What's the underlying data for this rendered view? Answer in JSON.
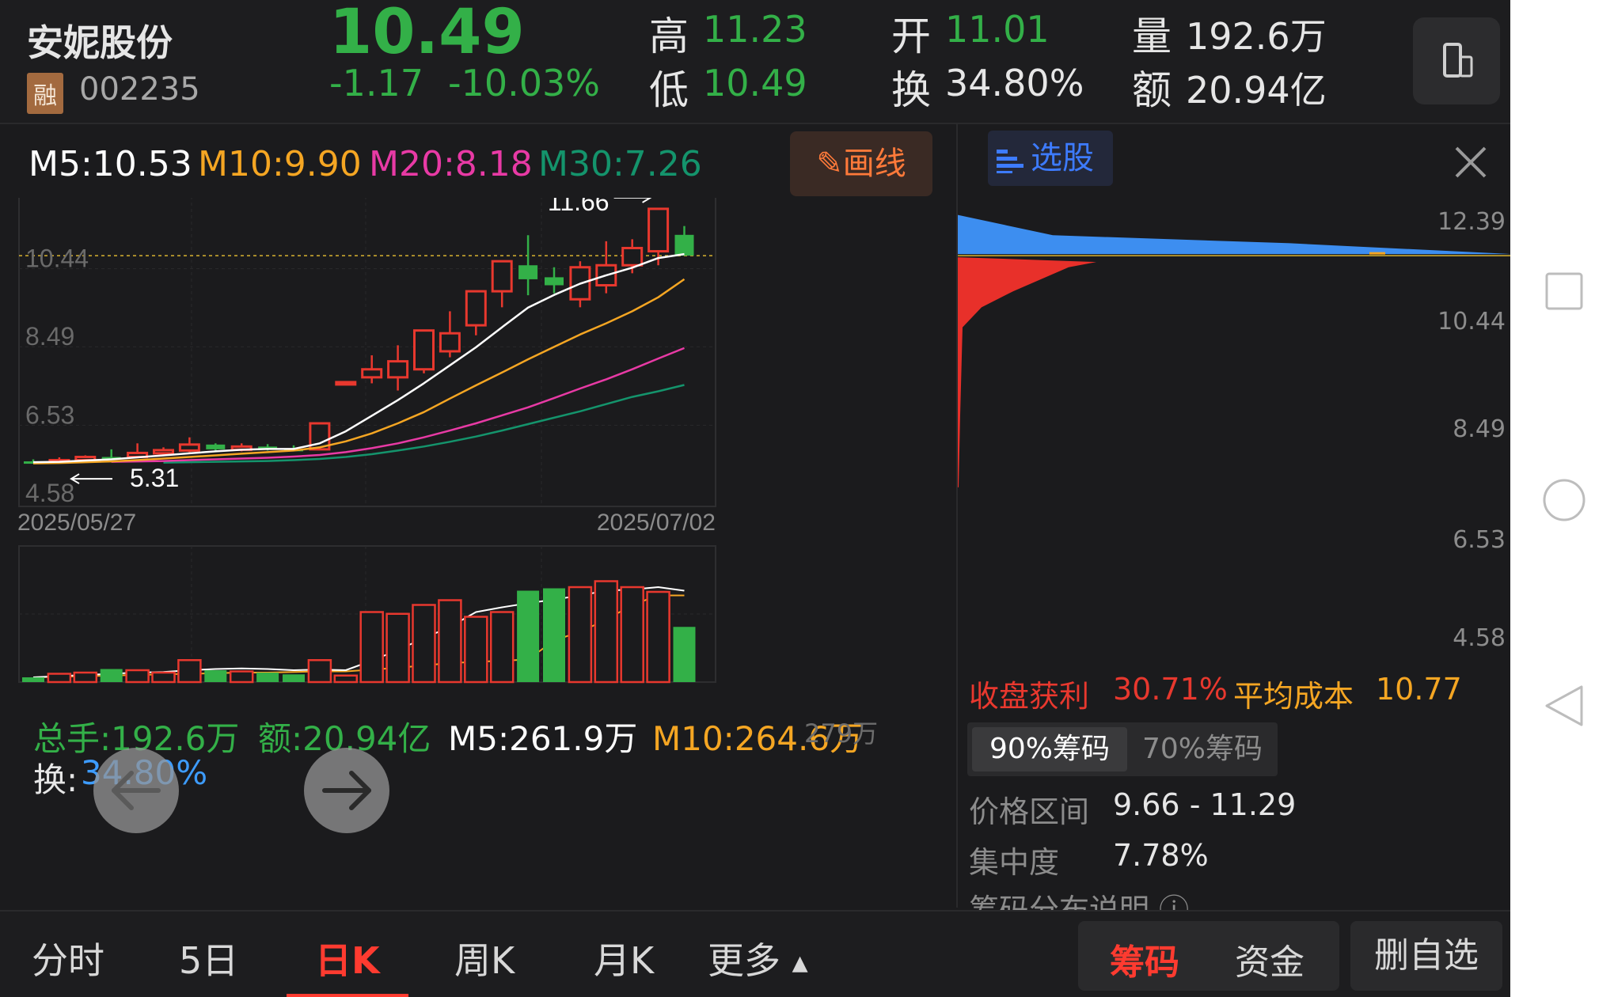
{
  "header": {
    "stock_name": "安妮股份",
    "margin_badge": "融",
    "stock_code": "002235",
    "price": "10.49",
    "change": "-1.17",
    "change_pct": "-10.03%",
    "high_label": "高",
    "high_value": "11.23",
    "low_label": "低",
    "low_value": "10.49",
    "open_label": "开",
    "open_value": "11.01",
    "turnover_label": "换",
    "turnover_value": "34.80%",
    "volume_label": "量",
    "volume_value": "192.6万",
    "amount_label": "额",
    "amount_value": "20.94亿"
  },
  "ma": {
    "m5": "M5:10.53",
    "m10": "M10:9.90",
    "m20": "M20:8.18",
    "m30": "M30:7.26"
  },
  "draw_button": "画线",
  "chart_data": {
    "type": "candlestick",
    "price_axis_ticks": [
      "12.39",
      "10.44",
      "8.49",
      "6.53",
      "4.58"
    ],
    "date_start": "2025/05/27",
    "date_end": "2025/07/02",
    "high_marker": "11.66",
    "low_marker": "5.31",
    "candles": [
      {
        "o": 5.35,
        "c": 5.33,
        "h": 5.4,
        "l": 5.31
      },
      {
        "o": 5.34,
        "c": 5.38,
        "h": 5.45,
        "l": 5.32
      },
      {
        "o": 5.38,
        "c": 5.46,
        "h": 5.5,
        "l": 5.35
      },
      {
        "o": 5.46,
        "c": 5.44,
        "h": 5.65,
        "l": 5.4
      },
      {
        "o": 5.46,
        "c": 5.56,
        "h": 5.8,
        "l": 5.44
      },
      {
        "o": 5.55,
        "c": 5.63,
        "h": 5.7,
        "l": 5.5
      },
      {
        "o": 5.62,
        "c": 5.77,
        "h": 5.95,
        "l": 5.58
      },
      {
        "o": 5.77,
        "c": 5.65,
        "h": 5.8,
        "l": 5.62
      },
      {
        "o": 5.64,
        "c": 5.72,
        "h": 5.8,
        "l": 5.6
      },
      {
        "o": 5.72,
        "c": 5.65,
        "h": 5.78,
        "l": 5.62
      },
      {
        "o": 5.66,
        "c": 5.64,
        "h": 5.75,
        "l": 5.62
      },
      {
        "o": 5.65,
        "c": 6.3,
        "h": 6.3,
        "l": 5.63
      },
      {
        "o": 7.32,
        "c": 7.33,
        "h": 7.33,
        "l": 7.32
      },
      {
        "o": 7.45,
        "c": 7.65,
        "h": 8.0,
        "l": 7.3
      },
      {
        "o": 7.45,
        "c": 7.85,
        "h": 8.25,
        "l": 7.12
      },
      {
        "o": 7.65,
        "c": 8.62,
        "h": 8.62,
        "l": 7.55
      },
      {
        "o": 8.1,
        "c": 8.55,
        "h": 9.1,
        "l": 7.95
      },
      {
        "o": 8.75,
        "c": 9.6,
        "h": 9.6,
        "l": 8.5
      },
      {
        "o": 9.6,
        "c": 10.35,
        "h": 10.35,
        "l": 9.2
      },
      {
        "o": 10.25,
        "c": 9.9,
        "h": 11.0,
        "l": 9.5
      },
      {
        "o": 9.95,
        "c": 9.75,
        "h": 10.2,
        "l": 9.55
      },
      {
        "o": 9.4,
        "c": 10.2,
        "h": 10.35,
        "l": 9.2
      },
      {
        "o": 9.75,
        "c": 10.25,
        "h": 10.85,
        "l": 9.55
      },
      {
        "o": 10.25,
        "c": 10.68,
        "h": 10.9,
        "l": 10.05
      },
      {
        "o": 10.6,
        "c": 11.66,
        "h": 11.66,
        "l": 10.25
      },
      {
        "o": 11.01,
        "c": 10.49,
        "h": 11.23,
        "l": 10.49
      }
    ],
    "ma5": [
      5.33,
      5.34,
      5.37,
      5.4,
      5.45,
      5.5,
      5.55,
      5.6,
      5.64,
      5.66,
      5.66,
      5.8,
      6.1,
      6.49,
      6.88,
      7.3,
      7.75,
      8.2,
      8.7,
      9.19,
      9.51,
      9.79,
      10.0,
      10.19,
      10.43,
      10.53
    ],
    "ma10": [
      5.3,
      5.31,
      5.33,
      5.35,
      5.38,
      5.42,
      5.46,
      5.5,
      5.54,
      5.58,
      5.62,
      5.7,
      5.85,
      6.05,
      6.3,
      6.58,
      6.92,
      7.25,
      7.57,
      7.9,
      8.21,
      8.52,
      8.8,
      9.1,
      9.45,
      9.9
    ],
    "ma20": [
      null,
      null,
      null,
      5.34,
      5.35,
      5.36,
      5.38,
      5.4,
      5.42,
      5.44,
      5.47,
      5.51,
      5.58,
      5.68,
      5.8,
      5.95,
      6.12,
      6.3,
      6.5,
      6.7,
      6.93,
      7.17,
      7.4,
      7.65,
      7.92,
      8.18
    ],
    "ma30": [
      null,
      null,
      null,
      null,
      null,
      5.32,
      5.33,
      5.34,
      5.35,
      5.36,
      5.38,
      5.41,
      5.46,
      5.53,
      5.62,
      5.72,
      5.84,
      5.97,
      6.12,
      6.28,
      6.44,
      6.6,
      6.78,
      6.96,
      7.1,
      7.26
    ],
    "volume_units": "万",
    "volume_axis_max": "279万",
    "volumes": [
      8,
      14,
      16,
      22,
      20,
      16,
      37,
      20,
      18,
      16,
      13,
      37,
      11,
      118,
      115,
      130,
      138,
      110,
      118,
      154,
      158,
      160,
      170,
      160,
      152,
      93
    ],
    "vol_ma5": [
      8,
      10,
      12,
      14,
      16,
      17,
      20,
      22,
      23,
      22,
      20,
      21,
      20,
      36,
      54,
      74,
      93,
      118,
      126,
      133,
      139,
      146,
      154,
      156,
      160,
      154
    ],
    "vol_ma10": [
      8,
      9,
      10,
      11,
      12,
      13,
      14,
      15,
      16,
      16,
      17,
      18,
      18,
      21,
      24,
      28,
      32,
      34,
      36,
      38,
      70,
      85,
      105,
      130,
      146,
      146
    ]
  },
  "volume_panel": {
    "total_hands": "总手:192.6万",
    "amount": "额:20.94亿",
    "m5": "M5:261.9万",
    "m10": "M10:264.6万",
    "axis_max": "279万",
    "turnover_label": "换:",
    "turnover_value": "34.80%"
  },
  "chip_panel": {
    "select_stock": "选股",
    "axis_ticks": [
      "12.39",
      "10.44",
      "8.49",
      "6.53",
      "4.58"
    ],
    "profit_label": "收盘获利",
    "profit_value": "30.71%",
    "avg_cost_label": "平均成本",
    "avg_cost_value": "10.77",
    "tab_90": "90%筹码",
    "tab_70": "70%筹码",
    "range_label": "价格区间",
    "range_value": "9.66 - 11.29",
    "concentration_label": "集中度",
    "concentration_value": "7.78%",
    "note_label": "筹码分布说明"
  },
  "bottom_tabs": [
    "分时",
    "5日",
    "日K",
    "周K",
    "月K",
    "更多"
  ],
  "bottom_actions": {
    "chip": "筹码",
    "capital": "资金",
    "delete": "删自选"
  },
  "colors": {
    "up": "#e8382e",
    "down": "#33b048",
    "ma5": "#ffffff",
    "ma10": "#f5a623",
    "ma20": "#e83aa5",
    "ma30": "#14946c",
    "chip_profit": "#3d8ef0",
    "chip_loss": "#e8302a"
  }
}
